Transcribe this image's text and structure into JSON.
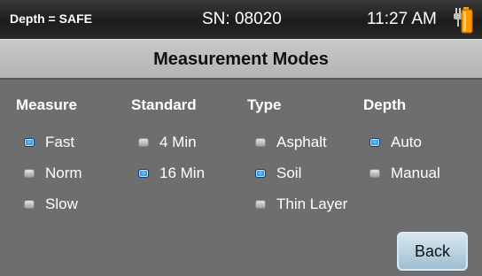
{
  "status": {
    "depth": "Depth = SAFE",
    "serial": "SN: 08020",
    "time": "11:27 AM",
    "battery_icon": "battery-plug-icon"
  },
  "title": "Measurement Modes",
  "columns": [
    {
      "header": "Measure",
      "options": [
        {
          "label": "Fast",
          "selected": true
        },
        {
          "label": "Norm",
          "selected": false
        },
        {
          "label": "Slow",
          "selected": false
        }
      ]
    },
    {
      "header": "Standard",
      "options": [
        {
          "label": "4 Min",
          "selected": false
        },
        {
          "label": "16 Min",
          "selected": true
        }
      ]
    },
    {
      "header": "Type",
      "options": [
        {
          "label": "Asphalt",
          "selected": false
        },
        {
          "label": "Soil",
          "selected": true
        },
        {
          "label": "Thin Layer",
          "selected": false
        }
      ]
    },
    {
      "header": "Depth",
      "options": [
        {
          "label": "Auto",
          "selected": true
        },
        {
          "label": "Manual",
          "selected": false
        }
      ]
    }
  ],
  "back_label": "Back",
  "colors": {
    "selected": "#1e7fd6",
    "background": "#6e6e6e",
    "title_bar": "#bdbdbd"
  }
}
